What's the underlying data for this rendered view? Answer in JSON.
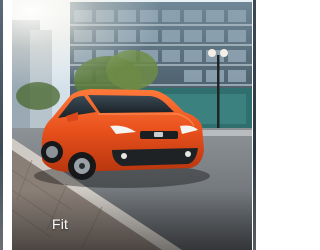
{
  "card": {
    "model_name": "Fit",
    "car_color": "#e8501c",
    "image_subject": "car-photo"
  }
}
